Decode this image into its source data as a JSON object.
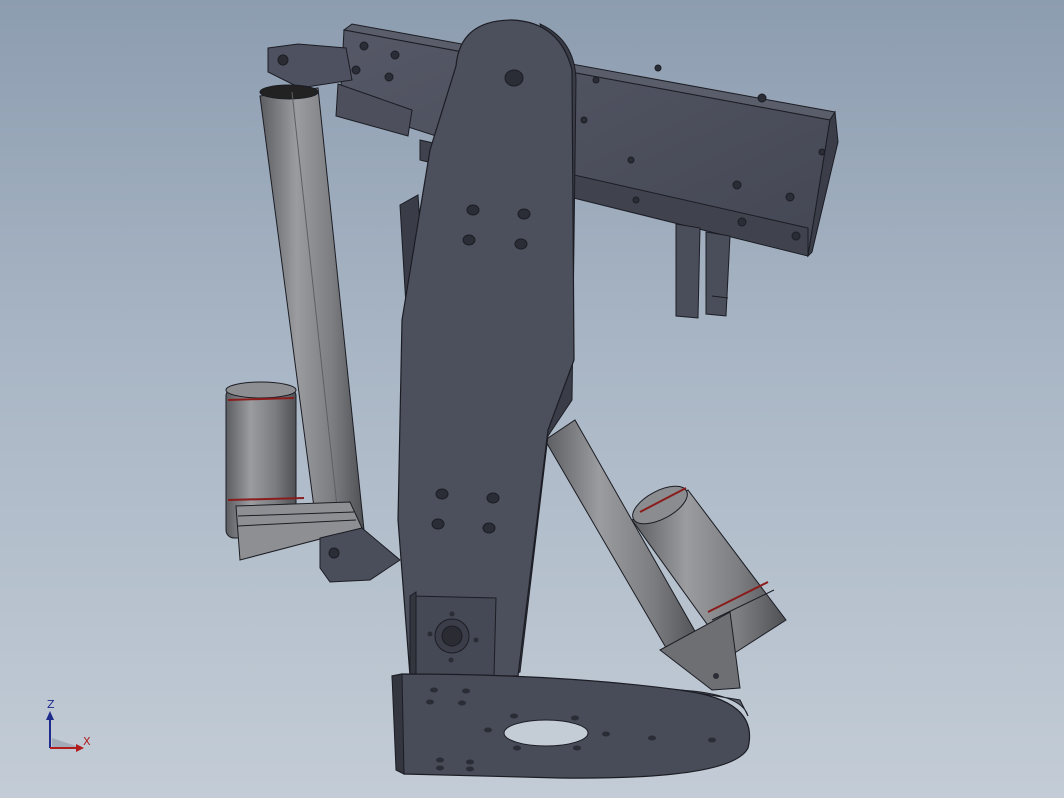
{
  "viewport": {
    "background_top": "#8d9db0",
    "background_bottom": "#c3ccd6"
  },
  "model": {
    "part_color": "#4a4d5a",
    "part_dark": "#383b46",
    "edge_color": "#1c1d24",
    "actuator_color": "#7a7b7e",
    "stripe_color": "#8a1c1c"
  },
  "triad": {
    "z_label": "Z",
    "x_label": "X",
    "z_color": "#1f2b8c",
    "x_color": "#b21c1c"
  }
}
